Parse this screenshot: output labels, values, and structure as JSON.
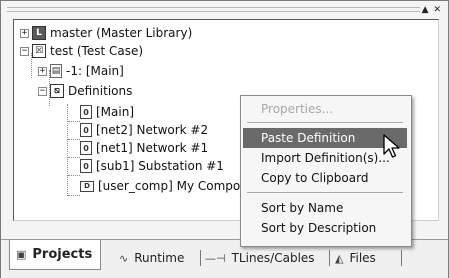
{
  "window": {
    "controls": "▲ ✕"
  },
  "tree": {
    "items": [
      {
        "expander": "+",
        "icon": "L",
        "label": "master (Master Library)"
      },
      {
        "expander": "−",
        "icon": "☒",
        "label": "test (Test Case)"
      },
      {
        "expander": "+",
        "icon": "▤",
        "label": "-1: [Main]"
      },
      {
        "expander": "−",
        "icon": "⧅",
        "label": "Definitions"
      },
      {
        "icon": "0",
        "label": "[Main]"
      },
      {
        "icon": "0",
        "label": "[net2] Network #2"
      },
      {
        "icon": "0",
        "label": "[net1] Network #1"
      },
      {
        "icon": "0",
        "label": "[sub1] Substation #1"
      },
      {
        "icon": "D",
        "label": "[user_comp] My Compon"
      }
    ]
  },
  "context_menu": {
    "items": [
      {
        "label": "Properties...",
        "state": "disabled"
      },
      {
        "label": "Paste Definition",
        "state": "highlighted"
      },
      {
        "label": "Import Definition(s)...",
        "state": "normal"
      },
      {
        "label": "Copy to Clipboard",
        "state": "normal"
      },
      {
        "label": "Sort by Name",
        "state": "normal"
      },
      {
        "label": "Sort by Description",
        "state": "normal"
      }
    ]
  },
  "tabs": [
    {
      "label": "Projects",
      "icon": "projects-icon",
      "glyph": "▣",
      "active": true
    },
    {
      "label": "Runtime",
      "icon": "runtime-icon",
      "glyph": "∿",
      "active": false
    },
    {
      "label": "TLines/Cables",
      "icon": "tlines-icon",
      "glyph": "—⊣",
      "active": false
    },
    {
      "label": "Files",
      "icon": "files-icon",
      "glyph": "◭",
      "active": false
    }
  ],
  "colors": {
    "menu_highlight": "#6a6a6a",
    "disabled_text": "#a8a8a8"
  }
}
